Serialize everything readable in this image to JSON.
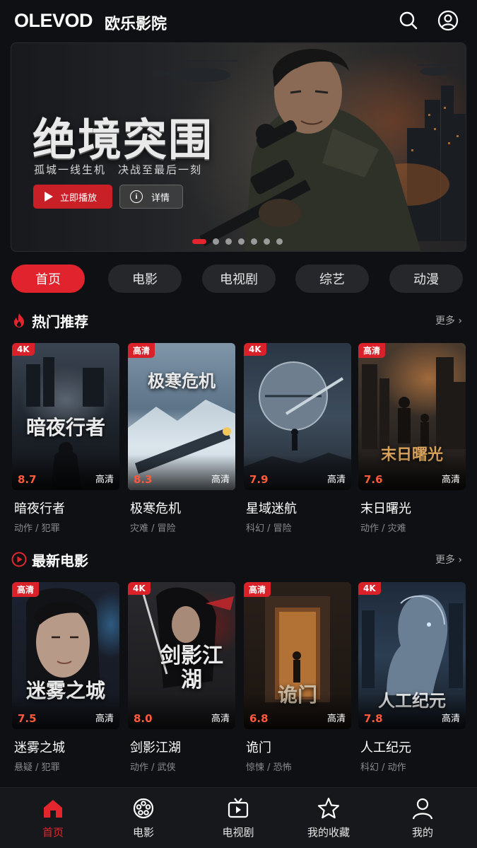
{
  "header": {
    "logo": "OLEVOD",
    "logo_cn": "欧乐影院",
    "search_icon": "search-icon",
    "user_icon": "user-circle-icon"
  },
  "banner": {
    "title": "绝境突围",
    "subtitle": "孤城一线生机　决战至最后一刻",
    "play_label": "立即播放",
    "detail_label": "详情",
    "slide_count": 7,
    "active_slide": 1
  },
  "tabs": [
    {
      "label": "首页",
      "active": true
    },
    {
      "label": "电影",
      "active": false
    },
    {
      "label": "电视剧",
      "active": false
    },
    {
      "label": "综艺",
      "active": false
    },
    {
      "label": "动漫",
      "active": false
    }
  ],
  "sections": [
    {
      "title": "热门推荐",
      "icon": "fire-icon",
      "more": "更多",
      "items": [
        {
          "title": "暗夜行者",
          "poster_text": "暗夜行者",
          "badge": "4K",
          "rating": "8.7",
          "quality": "高清",
          "genre": "动作 / 犯罪"
        },
        {
          "title": "极寒危机",
          "poster_text": "极寒危机",
          "badge": "高清",
          "rating": "8.3",
          "quality": "高清",
          "genre": "灾难 / 冒险"
        },
        {
          "title": "星域迷航",
          "poster_text": "",
          "badge": "4K",
          "rating": "7.9",
          "quality": "高清",
          "genre": "科幻 / 冒险"
        },
        {
          "title": "末日曙光",
          "poster_text": "末日曙光",
          "badge": "高清",
          "rating": "7.6",
          "quality": "高清",
          "genre": "动作 / 灾难"
        }
      ]
    },
    {
      "title": "最新电影",
      "icon": "play-circle-icon",
      "more": "更多",
      "items": [
        {
          "title": "迷雾之城",
          "poster_text": "迷雾之城",
          "badge": "高清",
          "rating": "7.5",
          "quality": "高清",
          "genre": "悬疑 / 犯罪"
        },
        {
          "title": "剑影江湖",
          "poster_text": "剑影江湖",
          "badge": "4K",
          "rating": "8.0",
          "quality": "高清",
          "genre": "动作 / 武侠"
        },
        {
          "title": "诡门",
          "poster_text": "诡门",
          "badge": "高清",
          "rating": "6.8",
          "quality": "高清",
          "genre": "惊悚 / 恐怖"
        },
        {
          "title": "人工纪元",
          "poster_text": "人工纪元",
          "badge": "4K",
          "rating": "7.8",
          "quality": "高清",
          "genre": "科幻 / 动作"
        }
      ]
    }
  ],
  "bottom_nav": [
    {
      "label": "首页",
      "icon": "home-icon",
      "active": true
    },
    {
      "label": "电影",
      "icon": "film-reel-icon",
      "active": false
    },
    {
      "label": "电视剧",
      "icon": "tv-icon",
      "active": false
    },
    {
      "label": "我的收藏",
      "icon": "star-icon",
      "active": false
    },
    {
      "label": "我的",
      "icon": "user-icon",
      "active": false
    }
  ],
  "colors": {
    "accent": "#e3262e",
    "background": "#0f1013",
    "tab_bg": "#26272b",
    "rating": "#ff5a3c"
  }
}
